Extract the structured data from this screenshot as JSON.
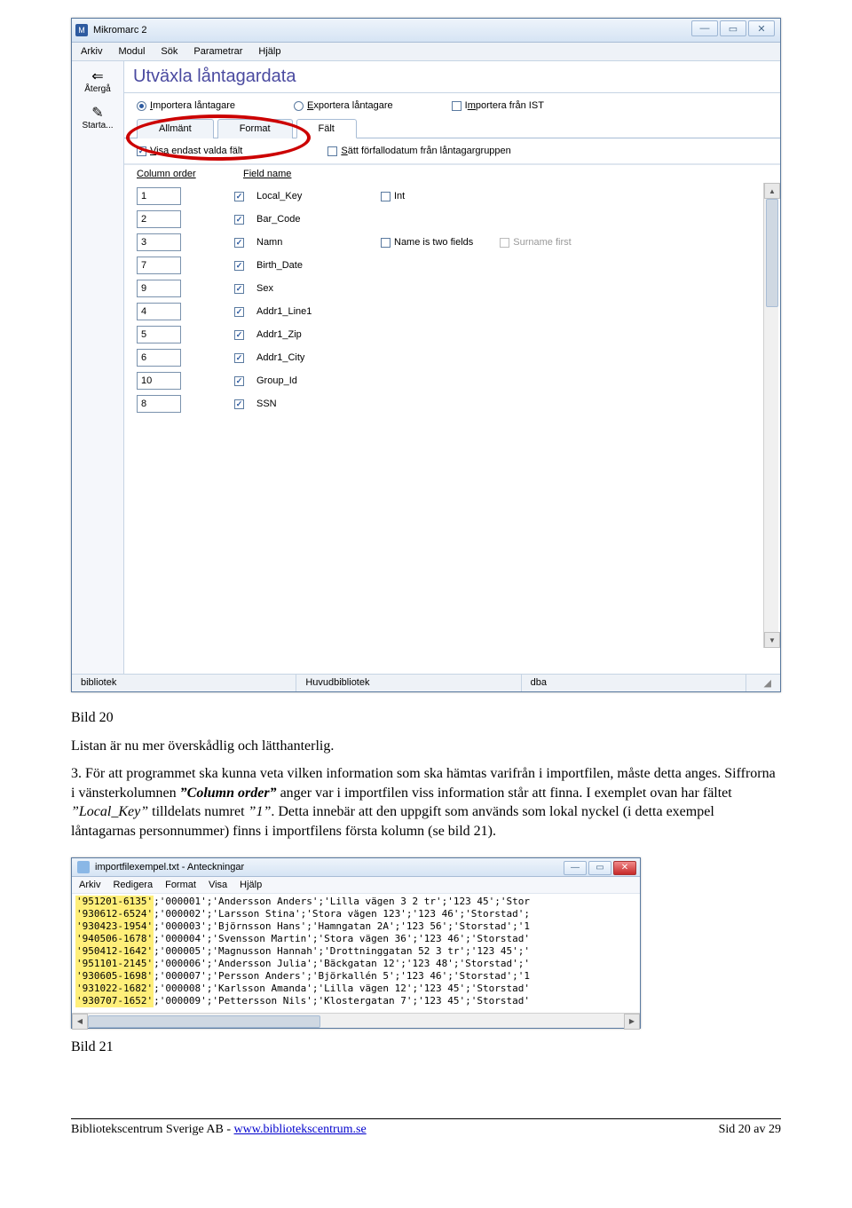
{
  "win1": {
    "title": "Mikromarc 2",
    "menubar": [
      "Arkiv",
      "Modul",
      "Sök",
      "Parametrar",
      "Hjälp"
    ],
    "left_toolbar": [
      {
        "glyph": "⇐",
        "label": "Återgå"
      },
      {
        "glyph": "✎",
        "label": "Starta..."
      }
    ],
    "panel_title": "Utväxla låntagardata",
    "radios": {
      "import": "Importera låntagare",
      "export": "Exportera låntagare",
      "ist": "Importera från IST"
    },
    "tabs": [
      "Allmänt",
      "Format",
      "Fält"
    ],
    "options": {
      "show_selected": "Visa endast valda fält",
      "set_due": "Sätt förfallodatum från låntagargruppen"
    },
    "col_headers": {
      "order": "Column order",
      "name": "Field name"
    },
    "fields": [
      {
        "order": "1",
        "name": "Local_Key",
        "extra": [
          {
            "label": "Int",
            "checked": false
          }
        ]
      },
      {
        "order": "2",
        "name": "Bar_Code"
      },
      {
        "order": "3",
        "name": "Namn",
        "extra": [
          {
            "label": "Name is two fields",
            "checked": false
          },
          {
            "label": "Surname first",
            "checked": false,
            "disabled": true
          }
        ]
      },
      {
        "order": "7",
        "name": "Birth_Date"
      },
      {
        "order": "9",
        "name": "Sex"
      },
      {
        "order": "4",
        "name": "Addr1_Line1"
      },
      {
        "order": "5",
        "name": "Addr1_Zip"
      },
      {
        "order": "6",
        "name": "Addr1_City"
      },
      {
        "order": "10",
        "name": "Group_Id"
      },
      {
        "order": "8",
        "name": "SSN"
      }
    ],
    "statusbar": [
      "bibliotek",
      "Huvudbibliotek",
      "dba"
    ]
  },
  "body": {
    "caption1": "Bild 20",
    "p1": "Listan är nu mer överskådlig och lätthanterlig.",
    "p2_lead": "3. För att programmet ska kunna veta vilken information som ska hämtas varifrån i importfilen, måste detta anges. Siffrorna i vänsterkolumnen ",
    "p2_em": "”Column order”",
    "p2_mid": " anger var i importfilen viss information står att finna. I exemplet ovan har fältet ",
    "p2_q": "”Local_Key”",
    "p2_mid2": " tilldelats numret ",
    "p2_q2": "”1”",
    "p2_tail": ". Detta innebär att den uppgift som används som lokal nyckel (i detta exempel låntagarnas personnummer) finns i importfilens första kolumn (se bild 21).",
    "caption2": "Bild 21"
  },
  "win2": {
    "title": "importfilexempel.txt - Anteckningar",
    "menubar": [
      "Arkiv",
      "Redigera",
      "Format",
      "Visa",
      "Hjälp"
    ],
    "lines": [
      {
        "hl": "'951201-6135'",
        "rest": ";'000001';'Andersson Anders';'Lilla vägen 3 2 tr';'123 45';'Stor"
      },
      {
        "hl": "'930612-6524'",
        "rest": ";'000002';'Larsson Stina';'Stora vägen 123';'123 46';'Storstad';"
      },
      {
        "hl": "'930423-1954'",
        "rest": ";'000003';'Björnsson Hans';'Hamngatan 2A';'123 56';'Storstad';'1"
      },
      {
        "hl": "'940506-1678'",
        "rest": ";'000004';'Svensson Martin';'Stora vägen 36';'123 46';'Storstad'"
      },
      {
        "hl": "'950412-1642'",
        "rest": ";'000005';'Magnusson Hannah';'Drottninggatan 52 3 tr';'123 45';'"
      },
      {
        "hl": "'951101-2145'",
        "rest": ";'000006';'Andersson Julia';'Bäckgatan 12';'123 48';'Storstad';'"
      },
      {
        "hl": "'930605-1698'",
        "rest": ";'000007';'Persson Anders';'Björkallén 5';'123 46';'Storstad';'1"
      },
      {
        "hl": "'931022-1682'",
        "rest": ";'000008';'Karlsson Amanda';'Lilla vägen 12';'123 45';'Storstad'"
      },
      {
        "hl": "'930707-1652'",
        "rest": ";'000009';'Pettersson Nils';'Klostergatan 7';'123 45';'Storstad'"
      }
    ]
  },
  "footer": {
    "left_pre": "Bibliotekscentrum Sverige AB - ",
    "left_link": "www.bibliotekscentrum.se",
    "right": "Sid 20 av 29"
  }
}
